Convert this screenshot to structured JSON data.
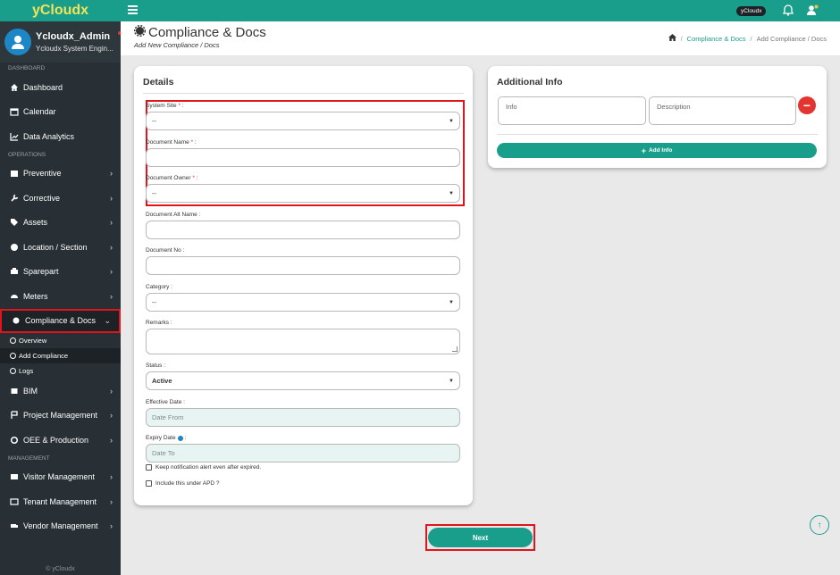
{
  "brand": "yCloudx",
  "user": {
    "name": "Ycloudx_Admin",
    "role": "Ycloudx System Engin..."
  },
  "sidebar": {
    "sections": {
      "dashboard": "DASHBOARD",
      "operations": "OPERATIONS",
      "management": "MANAGEMENT"
    },
    "items": [
      {
        "label": "Dashboard",
        "icon": "home-icon"
      },
      {
        "label": "Calendar",
        "icon": "calendar-icon"
      },
      {
        "label": "Data Analytics",
        "icon": "chart-icon"
      },
      {
        "label": "Preventive",
        "icon": "calendar-icon"
      },
      {
        "label": "Corrective",
        "icon": "wrench-icon"
      },
      {
        "label": "Assets",
        "icon": "tag-icon"
      },
      {
        "label": "Location / Section",
        "icon": "globe-icon"
      },
      {
        "label": "Sparepart",
        "icon": "sparepart-icon"
      },
      {
        "label": "Meters",
        "icon": "gauge-icon"
      },
      {
        "label": "Compliance & Docs",
        "icon": "gear-icon"
      },
      {
        "label": "BIM",
        "icon": "cube-icon"
      },
      {
        "label": "Project Management",
        "icon": "project-icon"
      },
      {
        "label": "OEE & Production",
        "icon": "factory-icon"
      },
      {
        "label": "Visitor Management",
        "icon": "id-card-icon"
      },
      {
        "label": "Tenant Management",
        "icon": "tenant-icon"
      },
      {
        "label": "Vendor Management",
        "icon": "vendor-icon"
      }
    ],
    "sub_items": [
      "Overview",
      "Add Compliance",
      "Logs"
    ],
    "footer": "© yCloudx"
  },
  "topbar": {
    "chip": "yCloudx"
  },
  "header": {
    "title": "Compliance & Docs",
    "subtitle": "Add New Compliance / Docs",
    "breadcrumb": {
      "link": "Compliance & Docs",
      "current": "Add Compliance / Docs"
    }
  },
  "details": {
    "title": "Details",
    "system_site": {
      "label": "System Site",
      "value": "--"
    },
    "document_name": {
      "label": "Document Name",
      "value": ""
    },
    "document_owner": {
      "label": "Document Owner",
      "value": "--"
    },
    "document_alt_name": {
      "label": "Document Alt Name :",
      "value": ""
    },
    "document_no": {
      "label": "Document No :",
      "value": ""
    },
    "category": {
      "label": "Category :",
      "value": "--"
    },
    "remarks": {
      "label": "Remarks :",
      "value": ""
    },
    "status": {
      "label": "Status :",
      "value": "Active"
    },
    "effective_date": {
      "label": "Effective Date :",
      "placeholder": "Date From"
    },
    "expiry_date": {
      "label": "Expiry Date",
      "placeholder": "Date To"
    },
    "keep_alert": "Keep notification alert even after expired.",
    "include_apd": "Include this under APD ?",
    "required_marker": "*",
    "colon": " :"
  },
  "additional": {
    "title": "Additional Info",
    "info_placeholder": "Info",
    "description_placeholder": "Description",
    "add_button": "Add Info"
  },
  "next_button": "Next",
  "colors": {
    "primary": "#1a9e8c",
    "sidebar": "#283035",
    "highlight": "#e1141c",
    "danger": "#e3342f",
    "brand_text": "#f3e35a"
  }
}
